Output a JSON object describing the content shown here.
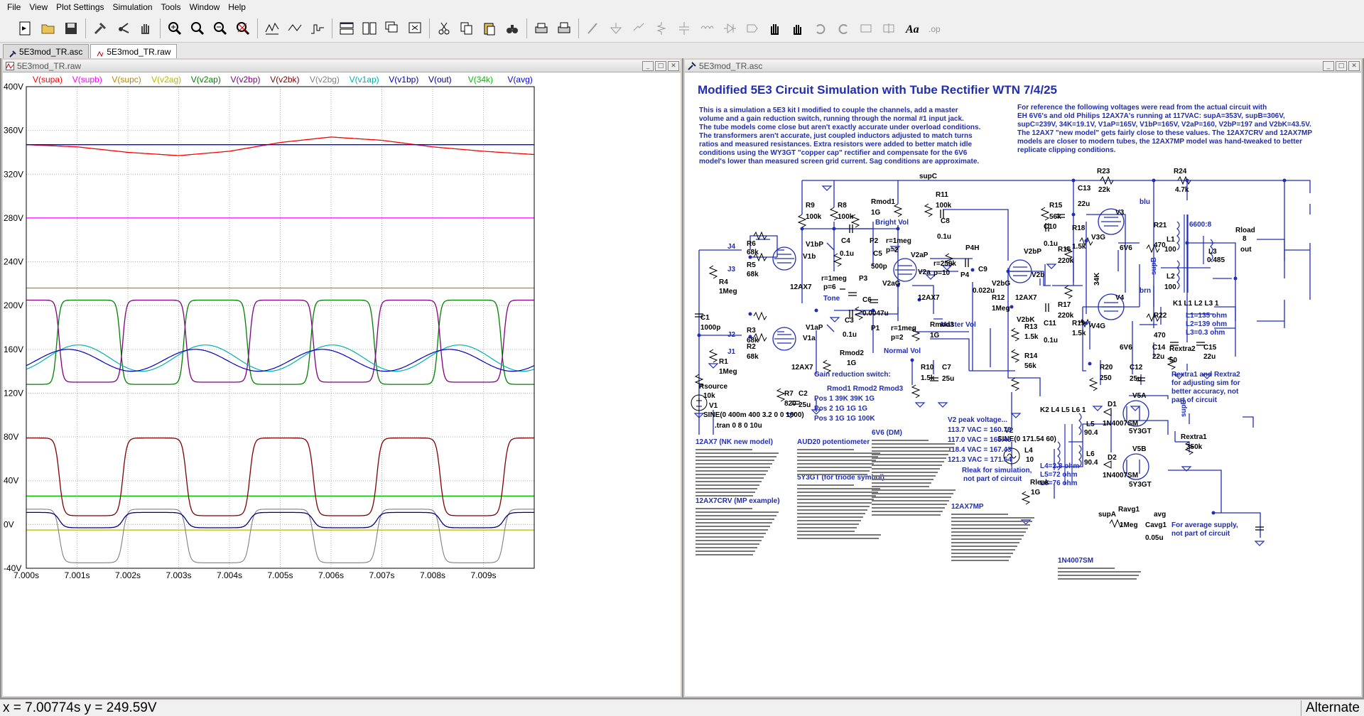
{
  "menu": [
    "File",
    "View",
    "Plot Settings",
    "Simulation",
    "Tools",
    "Window",
    "Help"
  ],
  "tabs": [
    {
      "label": "5E3mod_TR.asc",
      "active": false
    },
    {
      "label": "5E3mod_TR.raw",
      "active": true
    }
  ],
  "plot_window": {
    "title": "5E3mod_TR.raw"
  },
  "schematic_window": {
    "title": "5E3mod_TR.asc"
  },
  "status": {
    "coords": "x = 7.00774s   y = 249.59V",
    "mode": "Alternate"
  },
  "chart_data": {
    "type": "line",
    "title": "",
    "xlabel": "",
    "ylabel": "",
    "x_ticks": [
      "7.000s",
      "7.001s",
      "7.002s",
      "7.003s",
      "7.004s",
      "7.005s",
      "7.006s",
      "7.007s",
      "7.008s",
      "7.009s"
    ],
    "y_ticks": [
      "400V",
      "360V",
      "320V",
      "280V",
      "240V",
      "200V",
      "160V",
      "120V",
      "80V",
      "40V",
      "0V",
      "-40V"
    ],
    "xlim": [
      7.0,
      7.01
    ],
    "ylim": [
      -40,
      400
    ],
    "grid": true,
    "legend": [
      {
        "name": "V(supa)",
        "color": "#ff0000"
      },
      {
        "name": "V(supb)",
        "color": "#ff00ff"
      },
      {
        "name": "V(supc)",
        "color": "#b8860b"
      },
      {
        "name": "V(v2ag)",
        "color": "#b8b800"
      },
      {
        "name": "V(v2ap)",
        "color": "#008000"
      },
      {
        "name": "V(v2bp)",
        "color": "#800080"
      },
      {
        "name": "V(v2bk)",
        "color": "#800000"
      },
      {
        "name": "V(v2bg)",
        "color": "#808080"
      },
      {
        "name": "V(v1ap)",
        "color": "#00b0b0"
      },
      {
        "name": "V(v1bp)",
        "color": "#0000c0"
      },
      {
        "name": "V(out)",
        "color": "#000080"
      },
      {
        "name": "V(34k)",
        "color": "#00c000"
      },
      {
        "name": "V(avg)",
        "color": "#0000ff"
      }
    ],
    "series": [
      {
        "name": "V(supa)",
        "x": [
          7.0,
          7.001,
          7.002,
          7.003,
          7.004,
          7.005,
          7.006,
          7.007,
          7.008,
          7.009,
          7.01
        ],
        "values": [
          347,
          345,
          340,
          337,
          341,
          349,
          354,
          351,
          345,
          341,
          338
        ]
      },
      {
        "name": "V(supb)",
        "x": [
          7.0,
          7.01
        ],
        "values": [
          280,
          280
        ]
      },
      {
        "name": "V(supc)",
        "x": [
          7.0,
          7.01
        ],
        "values": [
          216,
          216
        ]
      },
      {
        "name": "V(avg)",
        "x": [
          7.0,
          7.01
        ],
        "values": [
          347,
          347
        ]
      },
      {
        "name": "V(34k)",
        "x": [
          7.0,
          7.01
        ],
        "values": [
          26,
          26
        ]
      },
      {
        "name": "V(v2ag)",
        "x": [
          7.0,
          7.01
        ],
        "values": [
          -5,
          -5
        ]
      }
    ]
  },
  "schematic": {
    "title": "Modified 5E3 Circuit Simulation with Tube Rectifier  WTN 7/4/25",
    "para_left": [
      "This is a simulation a 5E3 kit I modified to couple the channels, add a master",
      "volume and a gain reduction switch, running through the normal #1 input jack.",
      "The tube models come close but aren't exactly accurate under overload conditions.",
      "The transformers aren't accurate, just coupled inductors adjusted to match turns",
      "ratios and measured resistances. Extra resistors were added to better match idle",
      "conditions using the WY3GT \"copper cap\" rectifier and compensate for the 6V6",
      "model's lower than measured screen grid current. Sag conditions are approximate."
    ],
    "para_right": [
      "For reference the following voltages were read from the actual circuit with",
      "EH 6V6's and old Philips 12AX7A's running at 117VAC: supA=353V, supB=306V,",
      "supC=239V, 34K=19.1V, V1aP=165V, V1bP=165V, V2aP=160, V2bP=197 and V2bK=43.5V.",
      "The 12AX7 \"new model\" gets fairly close to these values. The 12AX7CRV and 12AX7MP",
      "models are closer to modern tubes, the 12AX7MP model was hand-tweaked to better",
      "replicate clipping conditions."
    ],
    "labels": {
      "supC": "supC",
      "R23": "R23",
      "R23v": "22k",
      "R24": "R24",
      "R24v": "4.7k",
      "R9": "R9",
      "R9v": "100k",
      "R8": "R8",
      "R8v": "100k",
      "Rmod1": "Rmod1",
      "Rmod1v": "1G",
      "R11": "R11",
      "R11v": "100k",
      "C13": "C13",
      "C13v": "22u",
      "R15": "R15",
      "R15v": "56k",
      "blu": "blu",
      "V3": "V3",
      "R21": "R21",
      "R21v": "470",
      "ot": "6600:8",
      "Rload": "Rload",
      "Rloadv": "8",
      "out": "out",
      "Bright": "Bright Vol",
      "C4": "C4",
      "C4v": "0.1u",
      "P2": "P2",
      "rmeg1": "r=1meg",
      "p2a": "p=2",
      "C5": "C5",
      "C5v": "500p",
      "V1bP": "V1bP",
      "V1b": "V1b",
      "J4": "J4",
      "R6": "R6",
      "R6v": "68k",
      "J3": "J3",
      "R5": "R5",
      "R5v": "68k",
      "R4": "R4",
      "R4v": "1Meg",
      "tube1": "12AX7",
      "rmeg2": "r=1meg",
      "p6": "p=6",
      "P3": "P3",
      "Tone": "Tone",
      "C6": "C6",
      "C6v": "0.0047u",
      "V2aG": "V2aG",
      "V2aP": "V2aP",
      "V2a": "V2a",
      "tube2": "12AX7",
      "C8": "C8",
      "C8v": "0.1u",
      "P4H": "P4H",
      "P4": "P4",
      "r250": "r=250k",
      "p10": "p=10",
      "Master": "Master Vol",
      "C9": "C9",
      "C9v": "0.022u",
      "R12": "R12",
      "R12v": "1Meg",
      "V2bG": "V2bG",
      "V2bP": "V2bP",
      "V2b": "V2b",
      "tube3": "12AX7",
      "C10": "C10",
      "C10v": "0.1u",
      "R18": "R18",
      "R18v": "1.5k",
      "V3G": "V3G",
      "R16": "R16",
      "R16v": "220k",
      "L1": "L1",
      "L1v": "100",
      "L3": "L3",
      "L3v": "0.485",
      "L2": "L2",
      "L2v": "100",
      "supB": "supB",
      "coup": "K1 L1 L2 L3 1",
      "brn": "brn",
      "Lvals1": "L1=135 ohm",
      "Lvals2": "L2=139 ohm",
      "Lvals3": "L3=0.3 ohm",
      "R17": "R17",
      "R17v": "220k",
      "C11": "C11",
      "C11v": "0.1u",
      "R19": "R19",
      "R19v": "1.5k",
      "V4G": "V4G",
      "V4": "V4",
      "R22": "R22",
      "R22v": "470",
      "k34": "34K",
      "tube6v6a": "6V6",
      "tube6v6b": "6V6",
      "C14": "C14",
      "C14v": "22u",
      "C15": "C15",
      "C15v": "22u",
      "C1": "C1",
      "C1v": "1000p",
      "V1aP": "V1aP",
      "V1a": "V1a",
      "C3": "C3",
      "C3v": "0.1u",
      "P1": "P1",
      "rmeg3": "r=1meg",
      "p2b": "p=2",
      "Normal": "Normal Vol",
      "Rmod3": "Rmod3",
      "Rmod3v": "1G",
      "J2": "J2",
      "R3": "R3",
      "R3v": "68k",
      "J1": "J1",
      "R2": "R2",
      "R2v": "68k",
      "R1": "R1",
      "R1v": "1Meg",
      "tube4": "12AX7",
      "Rmod2": "Rmod2",
      "Rmod2v": "1G",
      "R13": "R13",
      "R13v": "1.5k",
      "R14": "R14",
      "R14v": "56k",
      "V2bK": "V2bK",
      "R10": "R10",
      "R10v": "1.5k",
      "C7": "C7",
      "C7v": "25u",
      "R20": "R20",
      "R20v": "250",
      "C12": "C12",
      "C12v": "25u",
      "Rextra2": "Rextra2",
      "Rextra2v": "50",
      "Rsource": "Rsource",
      "Rsourcev": "10k",
      "R7": "R7",
      "R7v": "820",
      "C2": "C2",
      "C2v": "25u",
      "V1": "V1",
      "V1v": "SINE(0 400m 400 3.2 0 0 1600)",
      "tran": ".tran 0 8 0 10u",
      "gainhdr": "Gain reduction switch:",
      "ghdr": "Rmod1  Rmod2  Rmod3",
      "pos1": "Pos 1  39K     39K      1G",
      "pos2": "Pos 2  1G       1G       1G",
      "pos3": "Pos 3  1G       1G       100K",
      "extranote1": "Rextra1 and Rextra2",
      "extranote2": "for adjusting sim for",
      "extranote3": "better accuracy, not",
      "extranote4": "part of circuit",
      "V2": "V2",
      "V2v": "SINE(0 171.54 60)",
      "K2": "K2 L4 L5 L6 1",
      "L4": "L4",
      "L4v": "10",
      "L5": "L5",
      "L5v": "90.4",
      "L6": "L6",
      "L6v": "90.4",
      "D1": "D1",
      "D1v": "1N4007SM",
      "D2": "D2",
      "D2v": "1N4007SM",
      "V5A": "V5A",
      "V5Av": "5Y3GT",
      "V5B": "V5B",
      "V5Bv": "5Y3GT",
      "supBr": "supB",
      "Rextra1": "Rextra1",
      "Rextra1v": "350k",
      "Lr1": "L4=2.8 ohm",
      "Lr2": "L5=72 ohm",
      "Lr3": "L6=76 ohm",
      "peak": "V2 peak voltage...",
      "pk1": "113.7 VAC = 160.79",
      "pk2": "117.0 VAC = 165.45",
      "pk3": "118.4 VAC = 167.43",
      "pk4": "121.3 VAC = 171.54",
      "Rleak": "Rleak",
      "Rleakv": "1G",
      "rleaknote1": "Rleak for simulation,",
      "rleaknote2": "not part of circuit",
      "supA": "supA",
      "Ravg": "Ravg1",
      "Ravgv": "1Meg",
      "avg": "avg",
      "Cavg": "Cavg1",
      "Cavgv": "0.05u",
      "avgnote1": "For average supply,",
      "avgnote2": "not part of circuit",
      "m12ax7": "12AX7    (NK new model)",
      "m12ax7crv": "12AX7CRV  (MP example)",
      "maud": "AUD20 potentiometer",
      "m5y3": "5Y3GT (for triode symbol)",
      "m6v6": "6V6   (DM)",
      "m12mp": "12AX7MP",
      "m1n": "1N4007SM"
    }
  }
}
